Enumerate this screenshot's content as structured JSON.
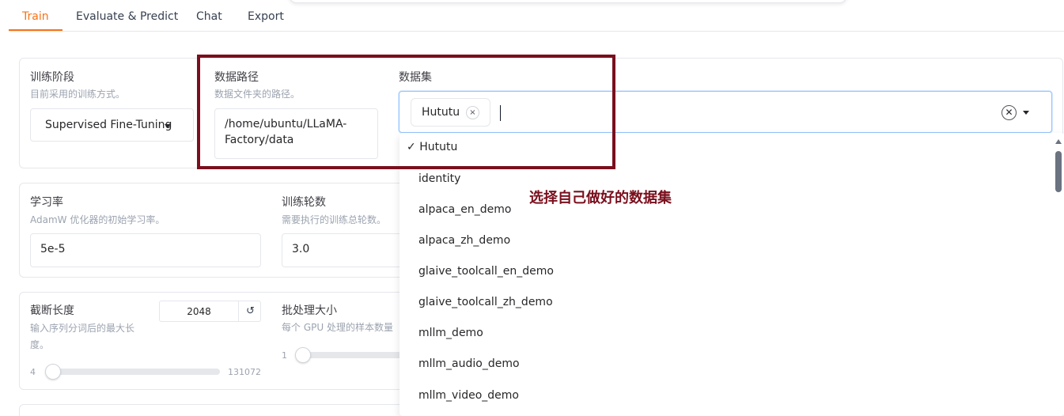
{
  "tabs": [
    "Train",
    "Evaluate & Predict",
    "Chat",
    "Export"
  ],
  "training_stage": {
    "label": "训练阶段",
    "info": "目前采用的训练方式。",
    "value": "Supervised Fine-Tuning"
  },
  "data_dir": {
    "label": "数据路径",
    "info": "数据文件夹的路径。",
    "value": "/home/ubuntu/LLaMA-Factory/data"
  },
  "dataset": {
    "label": "数据集",
    "selected_tokens": [
      "Hututu"
    ],
    "remove_glyph": "×",
    "clear_glyph": "✕",
    "options": [
      {
        "label": "Hututu",
        "selected": true,
        "check": "✓"
      },
      {
        "label": "identity"
      },
      {
        "label": "alpaca_en_demo"
      },
      {
        "label": "alpaca_zh_demo"
      },
      {
        "label": "glaive_toolcall_en_demo"
      },
      {
        "label": "glaive_toolcall_zh_demo"
      },
      {
        "label": "mllm_demo"
      },
      {
        "label": "mllm_audio_demo"
      },
      {
        "label": "mllm_video_demo"
      }
    ]
  },
  "learning_rate": {
    "label": "学习率",
    "info": "AdamW 优化器的初始学习率。",
    "value": "5e-5"
  },
  "epochs": {
    "label": "训练轮数",
    "info": "需要执行的训练总轮数。",
    "value": "3.0"
  },
  "cutoff_len": {
    "label": "截断长度",
    "info": "输入序列分词后的最大长度。",
    "value": "2048",
    "min": "4",
    "max": "131072",
    "reset_glyph": "↺"
  },
  "batch_size": {
    "label": "批处理大小",
    "info": "每个 GPU 处理的样本数量",
    "min": "1"
  },
  "annotation": "选择自己做好的数据集",
  "colors": {
    "accent": "#f97316",
    "annotation": "#7a0f1d",
    "focus": "#93c5fd"
  },
  "icons": {
    "remove": "close-icon",
    "clear": "clear-icon",
    "dropdown": "chevron-down-icon",
    "reset": "reset-icon"
  }
}
